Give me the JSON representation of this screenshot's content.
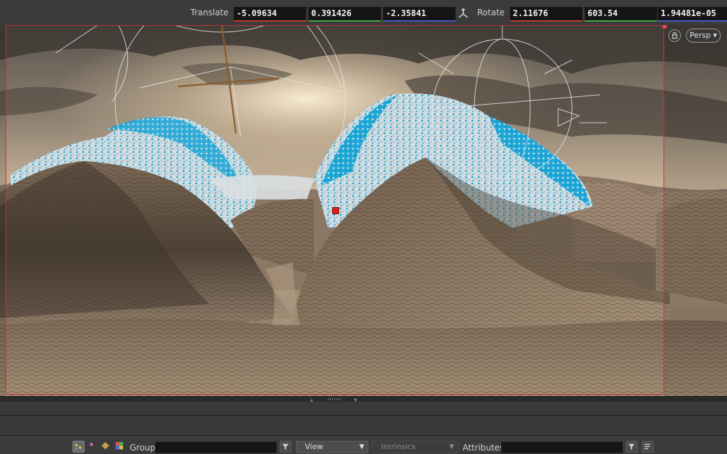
{
  "transform": {
    "translate_label": "Translate",
    "translate": [
      "-5.09634",
      "0.391426",
      "-2.35841"
    ],
    "rotate_label": "Rotate",
    "rotate": [
      "2.11676",
      "603.54",
      "1.94481e-05"
    ],
    "axis_colors": [
      "#c03a2b",
      "#3fa63f",
      "#4a57c8"
    ]
  },
  "viewport": {
    "camera_menu": "Persp",
    "frame_color": "#c8323a"
  },
  "spreadsheet": {
    "group_label": "Group:",
    "group_value": "",
    "view_menu": "View",
    "intrinsics_menu": "Intrinsics",
    "attributes_label": "Attributes:",
    "attributes_value": ""
  },
  "icons": [
    "transform-handle-icon",
    "lock-icon",
    "chevron-down-icon",
    "points-icon",
    "vertices-icon",
    "primitives-icon",
    "detail-icon",
    "filter-icon",
    "menu-icon"
  ]
}
